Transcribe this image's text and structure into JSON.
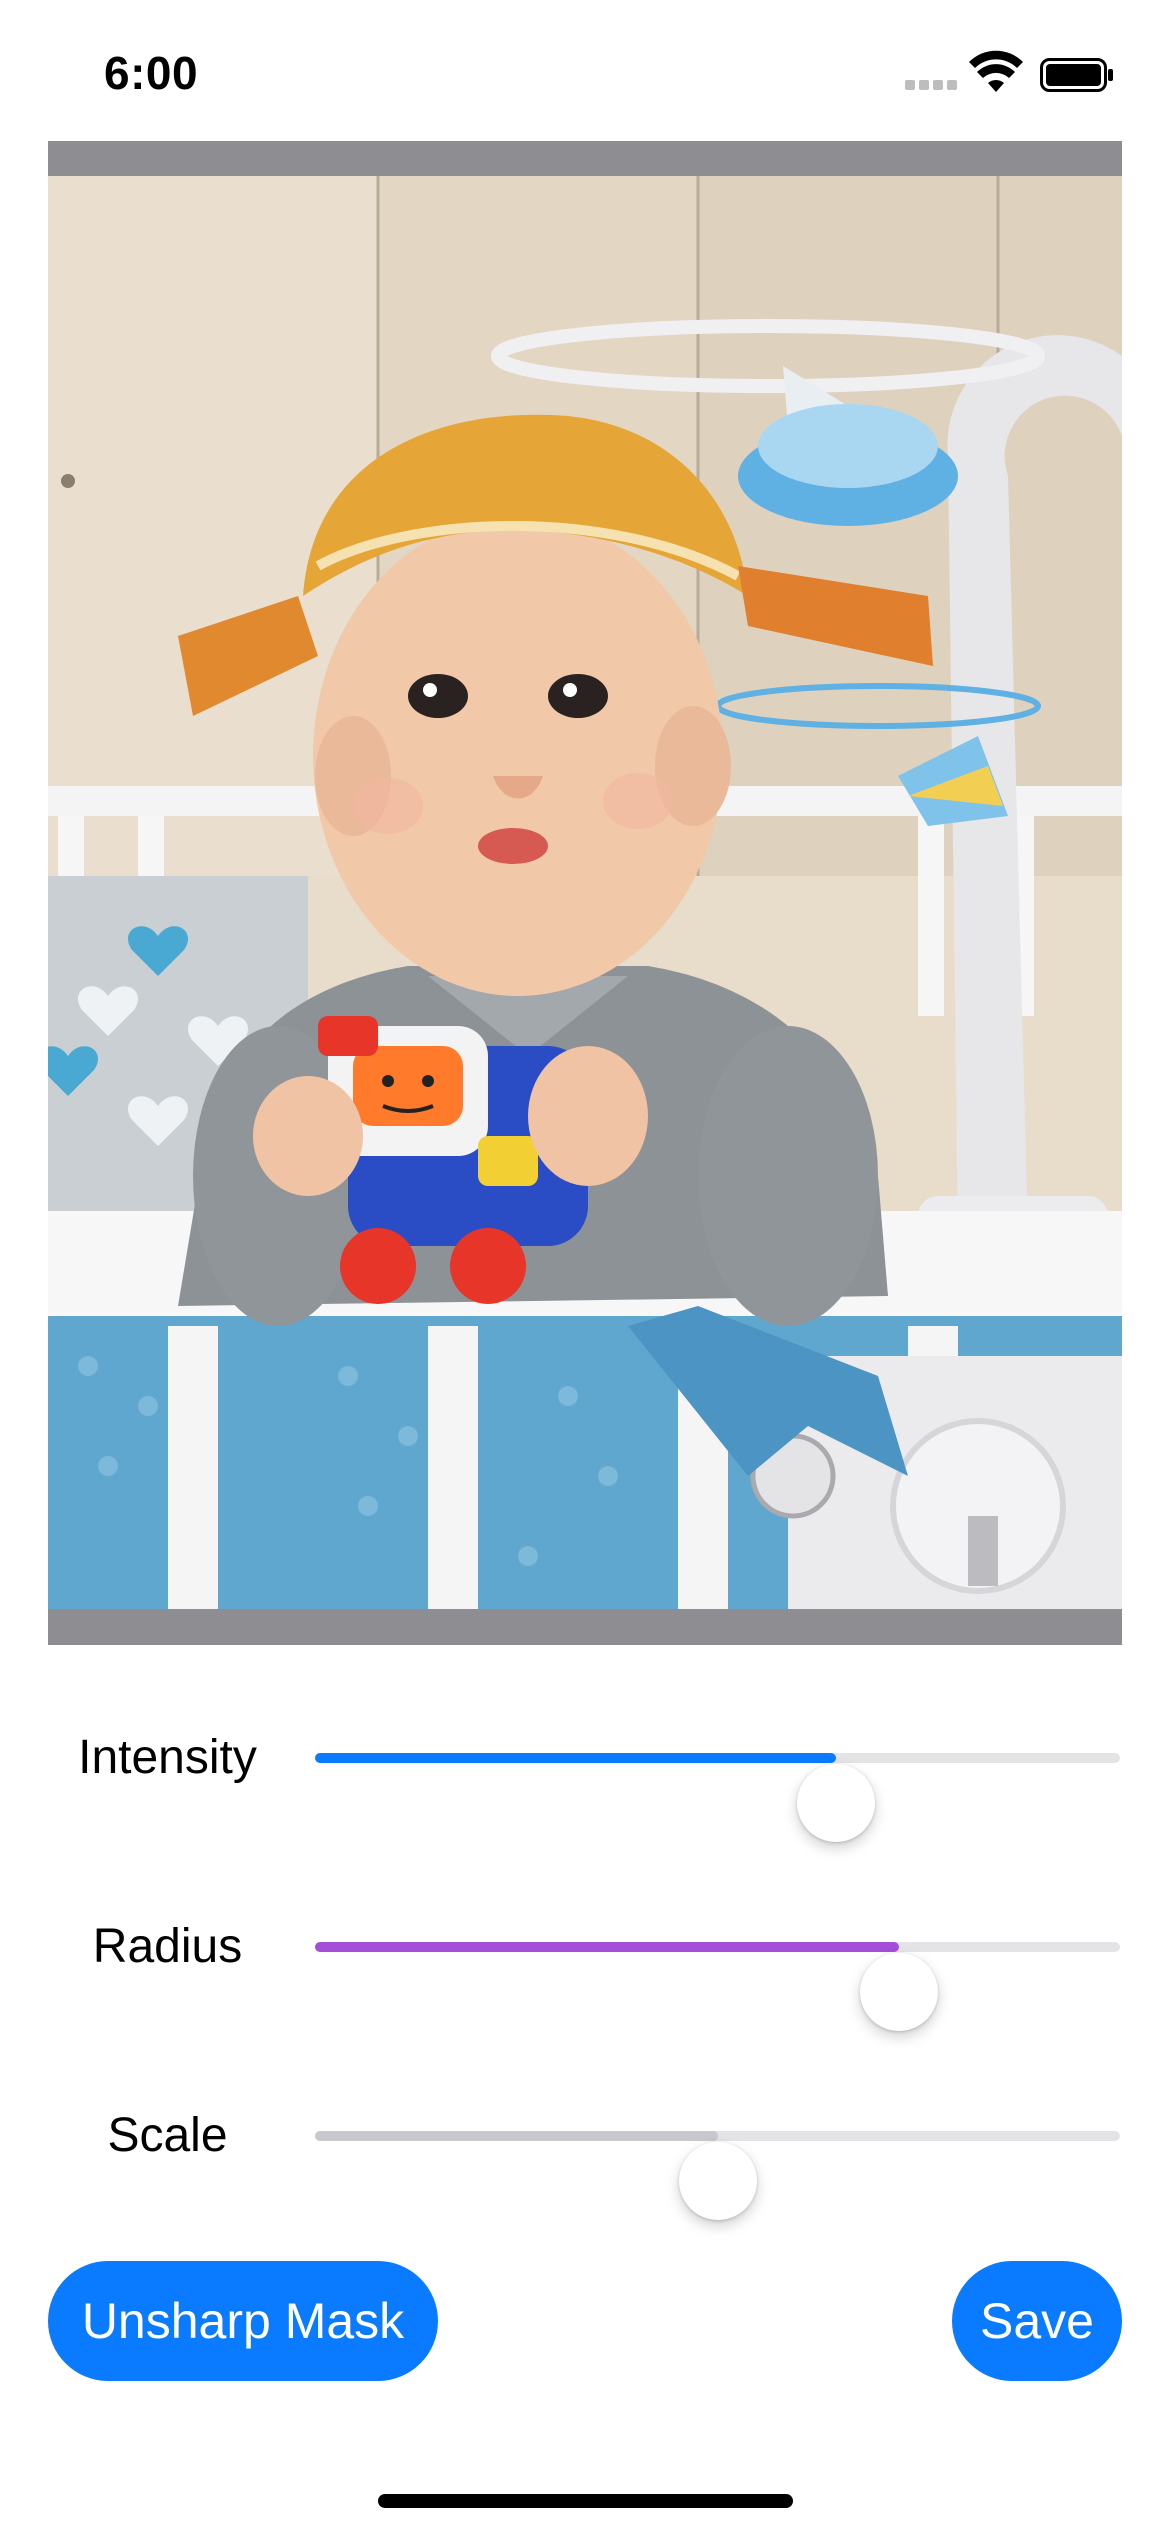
{
  "status_bar": {
    "time": "6:00"
  },
  "photo": {
    "description_icon": "baby-photo-image"
  },
  "sliders": [
    {
      "label": "Intensity",
      "value": 0.647,
      "fill_color": "#0a7aff"
    },
    {
      "label": "Radius",
      "value": 0.725,
      "fill_color": "#a54ed9"
    },
    {
      "label": "Scale",
      "value": 0.5,
      "fill_color": "#c7c7cc"
    }
  ],
  "buttons": {
    "filter_label": "Unsharp Mask",
    "save_label": "Save"
  },
  "colors": {
    "accent": "#0a7aff",
    "frame": "#8e8e92"
  }
}
